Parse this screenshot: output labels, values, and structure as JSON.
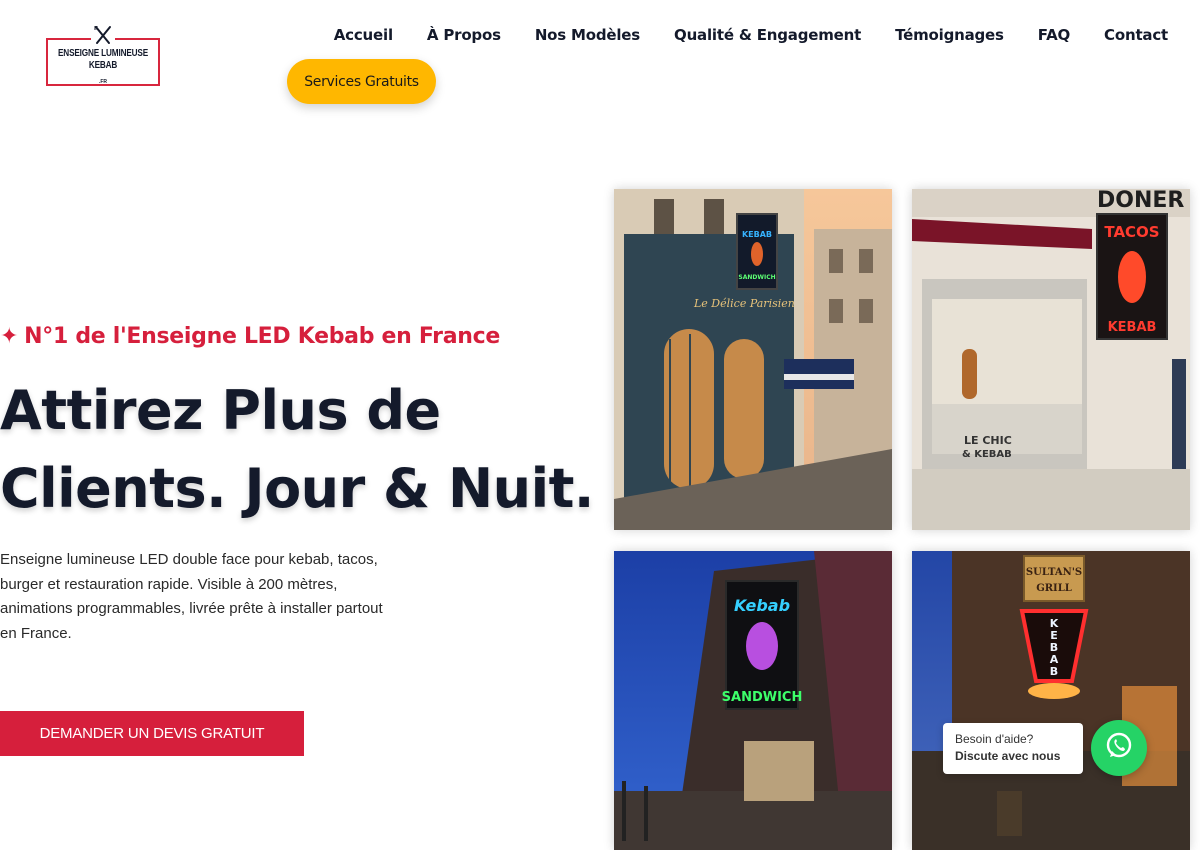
{
  "brand": {
    "logo_line1": "ENSEIGNE LUMINEUSE",
    "logo_line2": "KEBAB",
    "logo_suffix": ".FR",
    "logo_icon": "crossed-utensils-icon",
    "accent_color": "#d61f3c",
    "highlight_color": "#ffb700"
  },
  "nav": {
    "items": [
      "Accueil",
      "À Propos",
      "Nos Modèles",
      "Qualité & Engagement",
      "Témoignages",
      "FAQ",
      "Contact"
    ],
    "services_button": "Services Gratuits"
  },
  "hero": {
    "tagline_icon": "✦",
    "tagline": "N°1 de l'Enseigne LED Kebab en France",
    "headline_line1": "Attirez Plus de",
    "headline_line2": "Clients. Jour & Nuit.",
    "description": "Enseigne lumineuse LED double face pour kebab, tacos, burger et restauration rapide. Visible à 200 mètres, animations programmables, livrée prête à installer partout en France.",
    "cta": "DEMANDER UN DEVIS GRATUIT"
  },
  "gallery": {
    "photo1": {
      "storefront_sign": "Le Délice Parisien",
      "sign_top": "KEBAB",
      "sign_bottom": "SANDWICH"
    },
    "photo2": {
      "top_text": "DONER",
      "sign_top": "TACOS",
      "sign_bottom": "KEBAB",
      "window_text_1": "LE CHIC",
      "window_text_2": "& KEBAB"
    },
    "photo3": {
      "sign_top": "Kebab",
      "sign_bottom": "SANDWICH"
    },
    "photo4": {
      "sign_header_1": "SULTAN'S",
      "sign_header_2": "GRILL",
      "sign_vertical": "KEBAB"
    }
  },
  "chat": {
    "line1": "Besoin d'aide?",
    "line2": "Discute avec nous",
    "icon": "whatsapp-icon"
  }
}
